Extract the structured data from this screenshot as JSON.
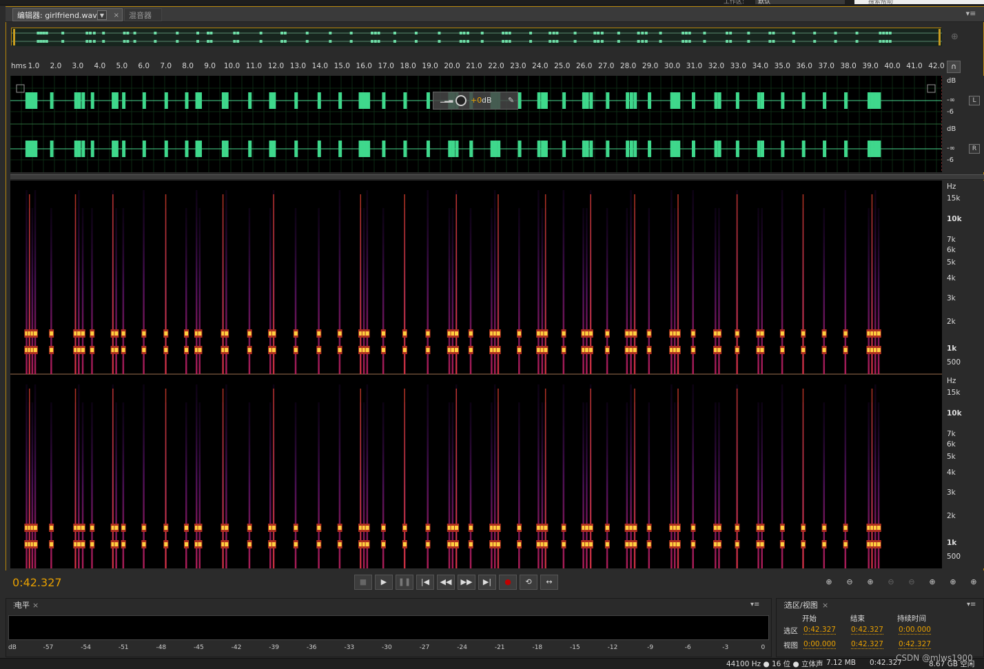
{
  "topbar": {
    "workspace_label": "工作区:",
    "workspace_value": "默认",
    "search_placeholder": "搜索帮助"
  },
  "tabs": [
    {
      "label": "编辑器: girlfriend.wav",
      "close": "×"
    },
    {
      "label": "混音器"
    }
  ],
  "ruler": {
    "unit": "hms",
    "ticks": [
      "1.0",
      "2.0",
      "3.0",
      "4.0",
      "5.0",
      "6.0",
      "7.0",
      "8.0",
      "9.0",
      "10.0",
      "11.0",
      "12.0",
      "13.0",
      "14.0",
      "15.0",
      "16.0",
      "17.0",
      "18.0",
      "19.0",
      "20.0",
      "21.0",
      "22.0",
      "23.0",
      "24.0",
      "25.0",
      "26.0",
      "27.0",
      "28.0",
      "29.0",
      "30.0",
      "31.0",
      "32.0",
      "33.0",
      "34.0",
      "35.0",
      "36.0",
      "37.0",
      "38.0",
      "39.0",
      "40.0",
      "41.0",
      "42.0"
    ]
  },
  "waveform": {
    "db_unit": "dB",
    "db_labels": [
      "-∞",
      "-6"
    ],
    "channels": [
      "L",
      "R"
    ],
    "bursts": [
      1.23,
      1.36,
      1.49,
      1.62,
      2.35,
      3.45,
      3.6,
      3.78,
      4.2,
      5.15,
      5.3,
      5.62,
      6.55,
      7.55,
      8.48,
      8.95,
      9.09,
      10.15,
      10.3,
      11.35,
      12.3,
      12.45,
      13.45,
      14.5,
      15.45,
      16.4,
      16.55,
      16.7,
      17.43,
      18.4,
      19.45,
      20.43,
      20.58,
      20.75,
      21.4,
      22.35,
      22.5,
      22.65,
      23.6,
      24.48,
      24.65,
      24.8,
      25.62,
      26.52,
      26.67,
      26.85,
      27.6,
      28.5,
      28.68,
      28.85,
      29.5,
      30.52,
      30.67,
      30.82,
      31.5,
      32.52,
      32.68,
      33.5,
      34.47,
      34.63,
      35.55,
      36.5,
      37.45,
      38.42,
      39.48,
      39.63,
      39.78,
      39.93
    ]
  },
  "hud": {
    "value": "+0",
    "unit": "dB"
  },
  "spectrogram": {
    "unit": "Hz",
    "labels": [
      "15k",
      "10k",
      "7k",
      "6k",
      "5k",
      "4k",
      "3k",
      "2k",
      "1k",
      "500"
    ]
  },
  "transport": {
    "timecode": "0:42.327",
    "buttons": [
      "stop-icon",
      "play-icon",
      "pause-icon",
      "go-to-start-icon",
      "rewind-icon",
      "fast-forward-icon",
      "go-to-end-icon",
      "record-icon",
      "loop-icon",
      "skip-selection-icon"
    ]
  },
  "level_panel": {
    "title": "电平",
    "labels": [
      "dB",
      "-57",
      "-54",
      "-51",
      "-48",
      "-45",
      "-42",
      "-39",
      "-36",
      "-33",
      "-30",
      "-27",
      "-24",
      "-21",
      "-18",
      "-15",
      "-12",
      "-9",
      "-6",
      "-3",
      "0"
    ]
  },
  "selection_panel": {
    "title": "选区/视图",
    "headers": {
      "start": "开始",
      "end": "结束",
      "duration": "持续时间"
    },
    "rows": [
      {
        "label": "选区",
        "start": "0:42.327",
        "end": "0:42.327",
        "duration": "0:00.000"
      },
      {
        "label": "视图",
        "start": "0:00.000",
        "end": "0:42.327",
        "duration": "0:42.327"
      }
    ]
  },
  "status": {
    "format": "44100 Hz ● 16 位 ● 立体声",
    "size": "7.12 MB",
    "duration": "0:42.327",
    "free": "8.67 GB 空闲",
    "watermark": "CSDN @mlws1900"
  },
  "colors": {
    "accent": "#e8a000",
    "wave": "#3fd88c",
    "panel_border": "#b8860b"
  }
}
